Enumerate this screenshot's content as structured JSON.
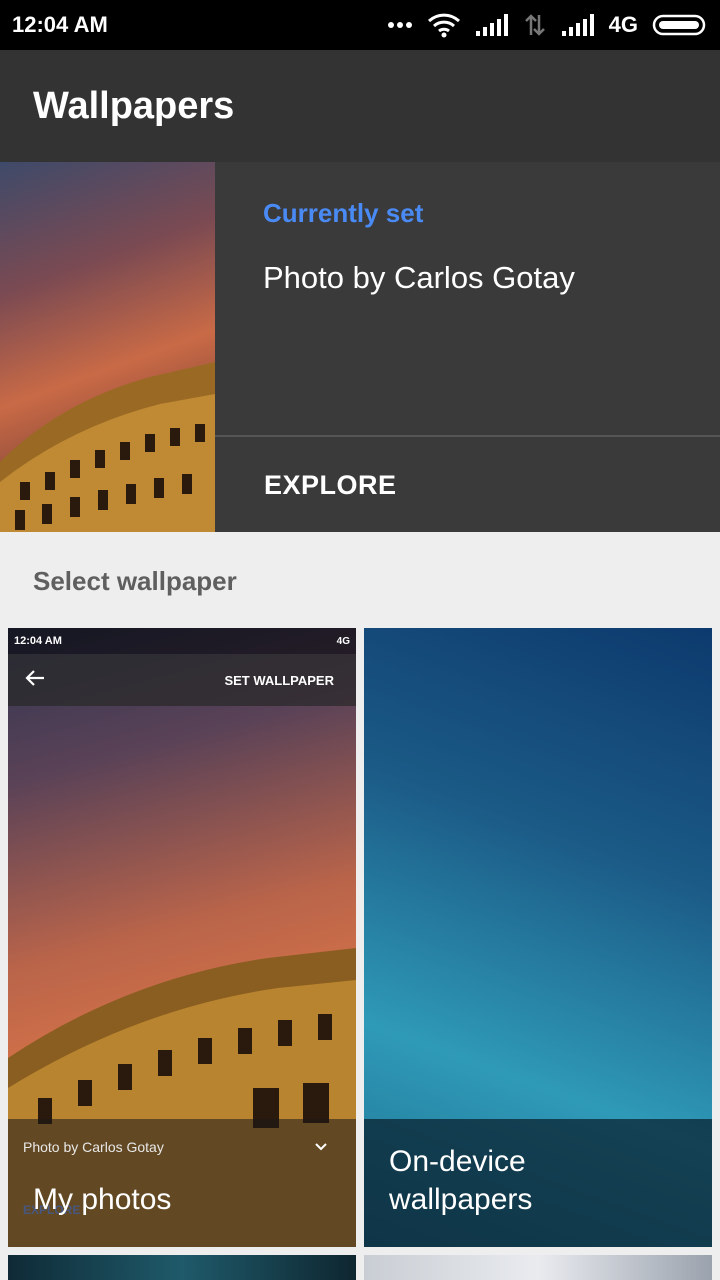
{
  "status_bar": {
    "time": "12:04 AM",
    "network": "4G"
  },
  "toolbar": {
    "title": "Wallpapers"
  },
  "current": {
    "label": "Currently set",
    "credit": "Photo by Carlos Gotay",
    "explore_label": "EXPLORE",
    "accent_color": "#4a8af4"
  },
  "section": {
    "heading": "Select wallpaper"
  },
  "tiles": [
    {
      "label": "My photos",
      "preview": {
        "time": "12:04 AM",
        "network": "4G",
        "action": "SET WALLPAPER",
        "credit": "Photo by Carlos Gotay",
        "explore": "EXPLORE"
      }
    },
    {
      "label": "On-device wallpapers"
    }
  ]
}
